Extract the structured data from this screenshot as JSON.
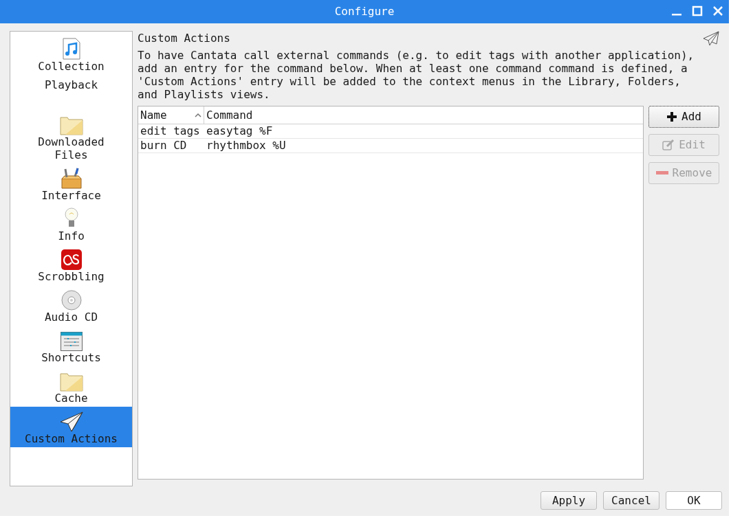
{
  "window": {
    "title": "Configure"
  },
  "sidebar": {
    "items": [
      {
        "label": "Collection",
        "selected": false
      },
      {
        "label": "Playback",
        "selected": false
      },
      {
        "label": "Downloaded Files",
        "selected": false
      },
      {
        "label": "Interface",
        "selected": false
      },
      {
        "label": "Info",
        "selected": false
      },
      {
        "label": "Scrobbling",
        "selected": false
      },
      {
        "label": "Audio CD",
        "selected": false
      },
      {
        "label": "Shortcuts",
        "selected": false
      },
      {
        "label": "Cache",
        "selected": false
      },
      {
        "label": "Custom Actions",
        "selected": true
      }
    ]
  },
  "page": {
    "title": "Custom Actions",
    "description": "To have Cantata call external commands (e.g. to edit tags with another application), add an entry for the command below. When at least one command command is defined, a 'Custom Actions' entry will be added to the context menus in the Library, Folders, and Playlists views."
  },
  "table": {
    "columns": [
      "Name",
      "Command"
    ],
    "rows": [
      {
        "name": "edit tags",
        "command": "easytag %F"
      },
      {
        "name": "burn CD",
        "command": "rhythmbox %U"
      }
    ]
  },
  "side_buttons": [
    {
      "label": "Add",
      "disabled": false
    },
    {
      "label": "Edit",
      "disabled": true
    },
    {
      "label": "Remove",
      "disabled": true
    }
  ],
  "buttons": [
    "Apply",
    "Cancel",
    "OK"
  ]
}
